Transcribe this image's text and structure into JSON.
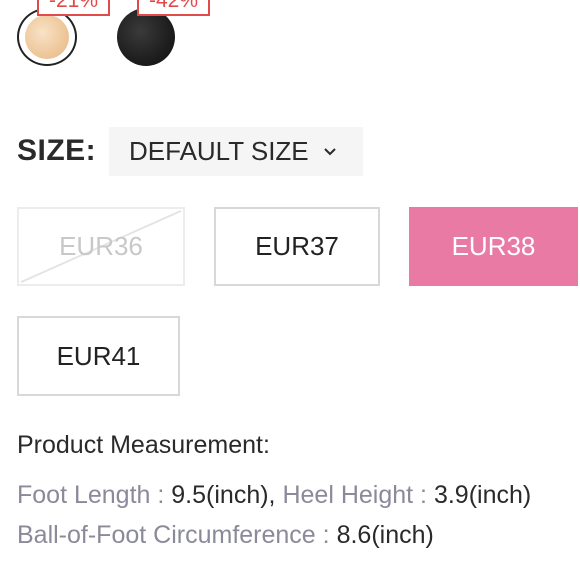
{
  "colors": {
    "accent": "#e97aa4",
    "discount": "#e24a4a"
  },
  "swatches": [
    {
      "name": "nude",
      "discount": "-21%",
      "selected": true
    },
    {
      "name": "black",
      "discount": "-42%",
      "selected": false
    }
  ],
  "size": {
    "label": "SIZE:",
    "selected_option": "DEFAULT SIZE",
    "options": [
      {
        "label": "EUR36",
        "state": "unavailable"
      },
      {
        "label": "EUR37",
        "state": "available"
      },
      {
        "label": "EUR38",
        "state": "selected"
      },
      {
        "label": "EUR41",
        "state": "available"
      }
    ]
  },
  "measurement": {
    "title": "Product Measurement:",
    "foot_length_label": "Foot Length :",
    "foot_length_value": "9.5(inch),",
    "heel_height_label": "Heel Height :",
    "heel_height_value": "3.9(inch)",
    "ball_label": "Ball-of-Foot Circumference :",
    "ball_value": "8.6(inch)"
  }
}
